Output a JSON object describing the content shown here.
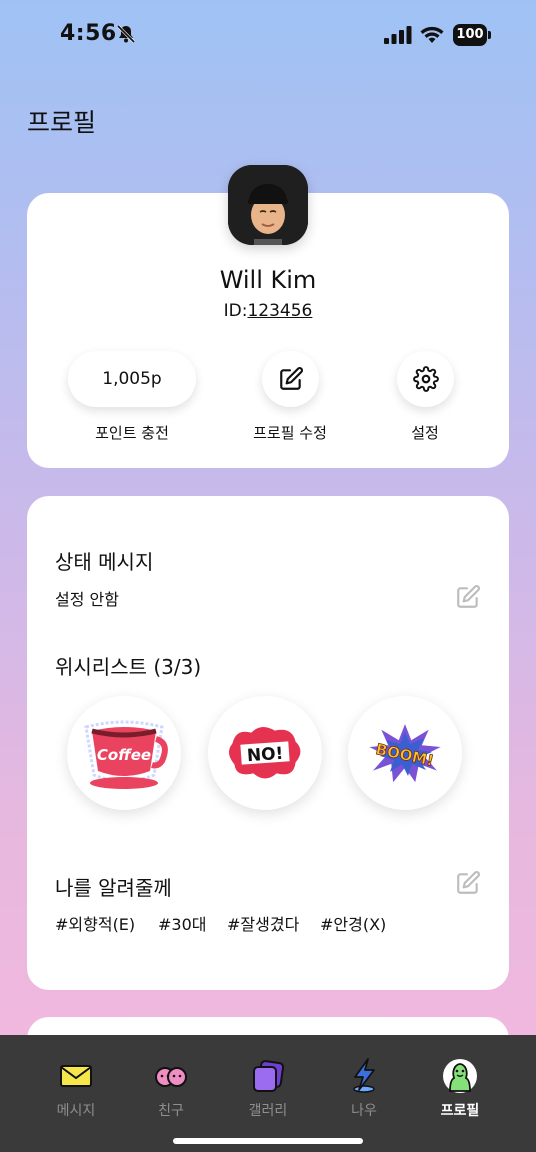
{
  "status_bar": {
    "time": "4:56",
    "battery": "100"
  },
  "header": {
    "title": "프로필"
  },
  "profile": {
    "name": "Will Kim",
    "id_label": "ID:",
    "id_value": "123456",
    "points": "1,005p",
    "points_label": "포인트 충전",
    "edit_label": "프로필 수정",
    "settings_label": "설정"
  },
  "status_message": {
    "title": "상태 메시지",
    "value": "설정 안함"
  },
  "wishlist": {
    "title": "위시리스트 (3/3)",
    "items": [
      {
        "icon": "coffee-sticker",
        "text": "Coffee"
      },
      {
        "icon": "no-sticker",
        "text": "NO!"
      },
      {
        "icon": "boom-sticker",
        "text": "BOOM!"
      }
    ]
  },
  "about": {
    "title": "나를 알려줄께",
    "tags": [
      "#외향적(E)",
      "#30대",
      "#잘생겼다",
      "#안경(X)"
    ]
  },
  "tab_bar": {
    "tabs": [
      {
        "label": "메시지",
        "icon": "envelope-icon",
        "active": false
      },
      {
        "label": "친구",
        "icon": "friends-icon",
        "active": false
      },
      {
        "label": "갤러리",
        "icon": "gallery-icon",
        "active": false
      },
      {
        "label": "나우",
        "icon": "lightning-icon",
        "active": false
      },
      {
        "label": "프로필",
        "icon": "profile-icon",
        "active": true
      }
    ]
  },
  "colors": {
    "accent_yellow": "#f6e64a",
    "accent_purple": "#8a56e6",
    "accent_blue": "#3b6fe0",
    "accent_green": "#86e07a",
    "tab_bar_bg": "#3a3a3a"
  }
}
